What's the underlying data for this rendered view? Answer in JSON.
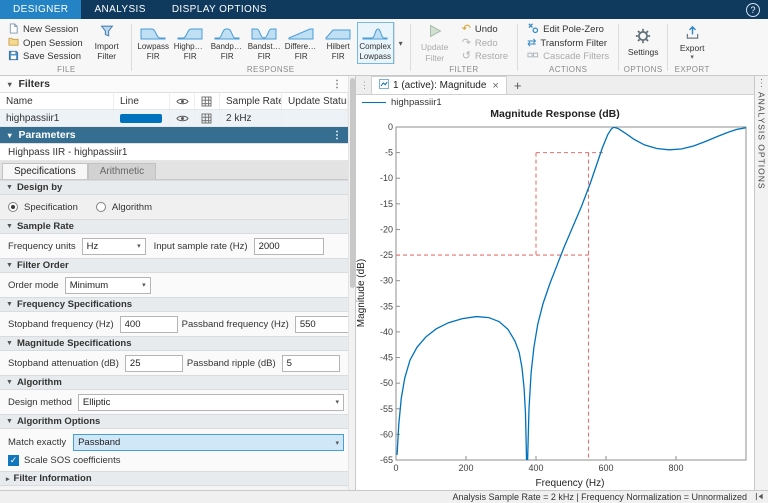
{
  "icons": {
    "expanded": "▼",
    "collapsed": "▸",
    "caret_down": "▾",
    "overflow": "⋮",
    "check": "✓",
    "undo": "↶",
    "redo": "↷",
    "restore": "↺",
    "transform": "⇄",
    "help": "?"
  },
  "toolstrip": {
    "tabs": [
      {
        "label": "DESIGNER"
      },
      {
        "label": "ANALYSIS"
      },
      {
        "label": "DISPLAY OPTIONS"
      }
    ],
    "selected_tab": "DESIGNER"
  },
  "ribbon": {
    "file": {
      "label": "FILE",
      "new_session": "New Session",
      "open_session": "Open Session",
      "save_session": "Save Session",
      "import_line1": "Import",
      "import_line2": "Filter"
    },
    "response": {
      "label": "RESPONSE",
      "items": [
        {
          "line1": "Lowpass",
          "line2": "FIR"
        },
        {
          "line1": "Highpass",
          "line2": "FIR"
        },
        {
          "line1": "Bandpass",
          "line2": "FIR"
        },
        {
          "line1": "Bandstop",
          "line2": "FIR"
        },
        {
          "line1": "Differentiator",
          "line2": "FIR"
        },
        {
          "line1": "Hilbert",
          "line2": "FIR"
        },
        {
          "line1": "Complex",
          "line2": "Lowpass"
        }
      ]
    },
    "filter": {
      "label": "FILTER",
      "update_line1": "Update",
      "update_line2": "Filter",
      "undo": "Undo",
      "redo": "Redo",
      "restore": "Restore"
    },
    "actions": {
      "label": "ACTIONS",
      "edit_pole_zero": "Edit Pole-Zero",
      "transform_filter": "Transform Filter",
      "cascade_filters": "Cascade Filters"
    },
    "options": {
      "label": "OPTIONS",
      "settings": "Settings"
    },
    "export": {
      "label": "EXPORT",
      "export": "Export"
    }
  },
  "filters_panel": {
    "title": "Filters",
    "columns": {
      "name": "Name",
      "line": "Line",
      "sample_rate": "Sample Rate",
      "update_status": "Update Status"
    },
    "rows": [
      {
        "name": "highpassiir1",
        "line_color": "#0072BD",
        "sample_rate": "2 kHz",
        "update_status": ""
      }
    ]
  },
  "parameters": {
    "title": "Parameters",
    "subtitle": "Highpass IIR - highpassiir1",
    "tabs": [
      {
        "label": "Specifications"
      },
      {
        "label": "Arithmetic"
      }
    ],
    "design_by": {
      "title": "Design by",
      "options": [
        "Specification",
        "Algorithm"
      ],
      "selected": "Specification"
    },
    "sample_rate": {
      "title": "Sample Rate",
      "frequency_units_label": "Frequency units",
      "frequency_units_value": "Hz",
      "input_rate_label": "Input sample rate (Hz)",
      "input_rate_value": "2000"
    },
    "filter_order": {
      "title": "Filter Order",
      "order_mode_label": "Order mode",
      "order_mode_value": "Minimum"
    },
    "frequency_specifications": {
      "title": "Frequency Specifications",
      "stopband_label": "Stopband frequency (Hz)",
      "stopband_value": "400",
      "passband_label": "Passband frequency (Hz)",
      "passband_value": "550"
    },
    "magnitude_specifications": {
      "title": "Magnitude Specifications",
      "attenuation_label": "Stopband attenuation (dB)",
      "attenuation_value": "25",
      "ripple_label": "Passband ripple (dB)",
      "ripple_value": "5"
    },
    "algorithm": {
      "title": "Algorithm",
      "design_method_label": "Design method",
      "design_method_value": "Elliptic"
    },
    "algorithm_options": {
      "title": "Algorithm Options",
      "match_label": "Match exactly",
      "match_value": "Passband",
      "scale_sos_label": "Scale SOS coefficients",
      "scale_sos_checked": true
    },
    "filter_information": {
      "title": "Filter Information"
    }
  },
  "plot_panel": {
    "tab_label": "1 (active): Magnitude",
    "close": "×",
    "add_tab": "+",
    "legend": "highpassiir1",
    "analysis_options_label": "ANALYSIS OPTIONS"
  },
  "status_bar": {
    "text": "Analysis Sample Rate = 2 kHz | Frequency Normalization = Unnormalized"
  },
  "chart_data": {
    "type": "line",
    "title": "Magnitude Response (dB)",
    "xlabel": "Frequency (Hz)",
    "ylabel": "Magnitude (dB)",
    "xlim": [
      0,
      1000
    ],
    "ylim": [
      -65,
      0
    ],
    "xticks": [
      0,
      200,
      400,
      600,
      800
    ],
    "yticks": [
      0,
      -5,
      -10,
      -15,
      -20,
      -25,
      -30,
      -35,
      -40,
      -45,
      -50,
      -55,
      -60,
      -65
    ],
    "grid": false,
    "legend_position": "top-left",
    "series": [
      {
        "name": "highpassiir1",
        "color": "#0072BD",
        "x": [
          3,
          8,
          15,
          25,
          40,
          60,
          85,
          115,
          150,
          190,
          230,
          265,
          295,
          320,
          340,
          352,
          360,
          366,
          370,
          373,
          376,
          380,
          386,
          394,
          405,
          420,
          440,
          460,
          480,
          505,
          530,
          555,
          575,
          590,
          605,
          615,
          622,
          635,
          655,
          680,
          710,
          745,
          780,
          815,
          850,
          885,
          920,
          950,
          975,
          1000
        ],
        "y": [
          -64,
          -58,
          -53,
          -49,
          -45.5,
          -43,
          -41,
          -39.4,
          -38.2,
          -37.4,
          -37,
          -37.2,
          -38,
          -39.5,
          -41.8,
          -44,
          -47,
          -51,
          -56,
          -65,
          -65,
          -55,
          -48,
          -43,
          -38.5,
          -34.5,
          -30.5,
          -27,
          -23.5,
          -19.5,
          -15.5,
          -11,
          -7,
          -4,
          -1.5,
          -0.4,
          -0.05,
          -0.3,
          -1.2,
          -2.4,
          -3.5,
          -4.2,
          -4.45,
          -4.3,
          -3.7,
          -2.8,
          -1.8,
          -1,
          -0.45,
          -0.15
        ]
      }
    ],
    "mask": {
      "color": "#e4726e",
      "style": "dashed",
      "segments": [
        [
          [
            0,
            -25
          ],
          [
            550,
            -25
          ]
        ],
        [
          [
            550,
            -5
          ],
          [
            550,
            -65
          ]
        ],
        [
          [
            400,
            -5
          ],
          [
            600,
            -5
          ]
        ],
        [
          [
            400,
            -5
          ],
          [
            400,
            -25
          ]
        ]
      ]
    }
  }
}
